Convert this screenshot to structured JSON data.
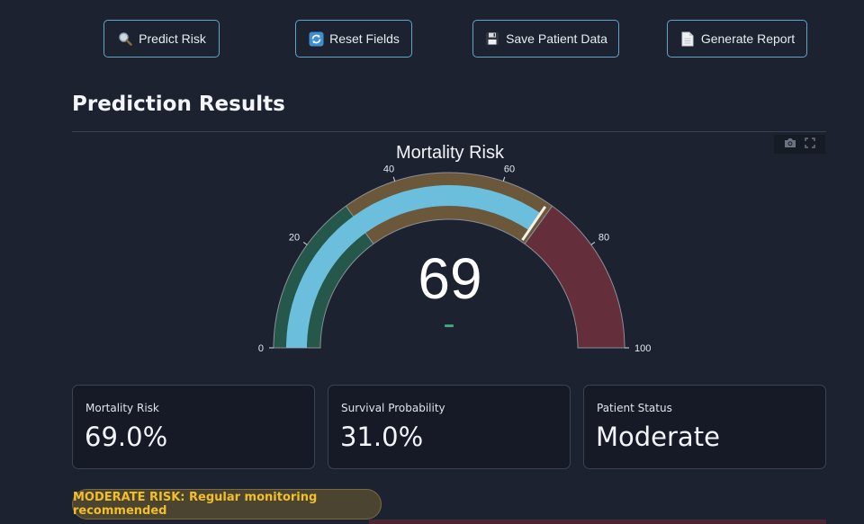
{
  "toolbar": {
    "predict_label": "Predict Risk",
    "reset_label": "Reset Fields",
    "save_label": "Save Patient Data",
    "report_label": "Generate Report",
    "predict_icon": "magnifier-icon",
    "reset_icon": "refresh-icon",
    "save_icon": "floppy-disk-icon",
    "report_icon": "document-icon"
  },
  "section_title": "Prediction Results",
  "gauge": {
    "title": "Mortality Risk",
    "value": 69,
    "value_text": "69",
    "range": [
      0,
      100
    ],
    "ticks": [
      "0",
      "20",
      "40",
      "60",
      "80",
      "100"
    ],
    "bands": [
      {
        "from": 0,
        "to": 30,
        "color": "#25574a"
      },
      {
        "from": 30,
        "to": 70,
        "color": "#6b573a"
      },
      {
        "from": 70,
        "to": 100,
        "color": "#642f3a"
      }
    ],
    "bar_color": "#6cbedd",
    "threshold": 69,
    "threshold_color": "#f4f1e6",
    "delta_color": "#3aa87e",
    "modebar_icons": [
      "camera-icon",
      "fullscreen-icon"
    ]
  },
  "metrics": [
    {
      "label": "Mortality Risk",
      "value": "69.0%"
    },
    {
      "label": "Survival Probability",
      "value": "31.0%"
    },
    {
      "label": "Patient Status",
      "value": "Moderate"
    }
  ],
  "alert": {
    "text": "MODERATE RISK: Regular monitoring recommended",
    "color": "#f2bf2a"
  },
  "colors": {
    "background": "#1d2230",
    "button_border": "#5fa6c8",
    "card_background": "#151a26"
  }
}
